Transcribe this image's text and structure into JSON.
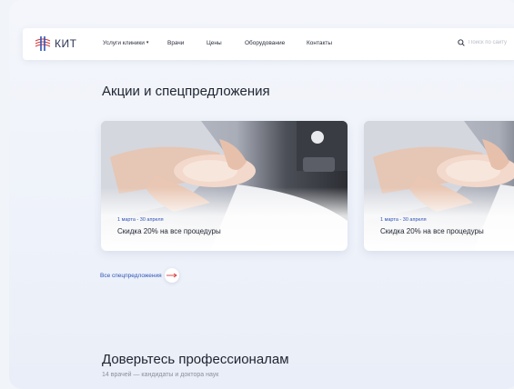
{
  "header": {
    "logo_text": "КИТ",
    "nav": [
      {
        "label": "Услуги клиники",
        "has_dropdown": true
      },
      {
        "label": "Врачи"
      },
      {
        "label": "Цены"
      },
      {
        "label": "Оборудование"
      },
      {
        "label": "Контакты"
      }
    ],
    "search_placeholder": "Поиск по сайту"
  },
  "promotions": {
    "title": "Акции и спецпредложения",
    "cards": [
      {
        "date": "1 марта - 30 апреля",
        "title": "Скидка 20% на все процедуры"
      },
      {
        "date": "1 марта - 30 апреля",
        "title": "Скидка 20% на все процедуры"
      }
    ],
    "all_link": "Все спецпредложения"
  },
  "doctors": {
    "title": "Доверьтесь профессионалам",
    "subtitle": "14 врачей — кандидаты и доктора наук"
  },
  "colors": {
    "accent": "#2f53b6",
    "logo_red": "#d8383a",
    "logo_blue": "#2f53b6"
  },
  "icons": {
    "search": "search-icon",
    "dropdown": "chevron-down-icon",
    "arrow": "arrow-right-icon"
  }
}
